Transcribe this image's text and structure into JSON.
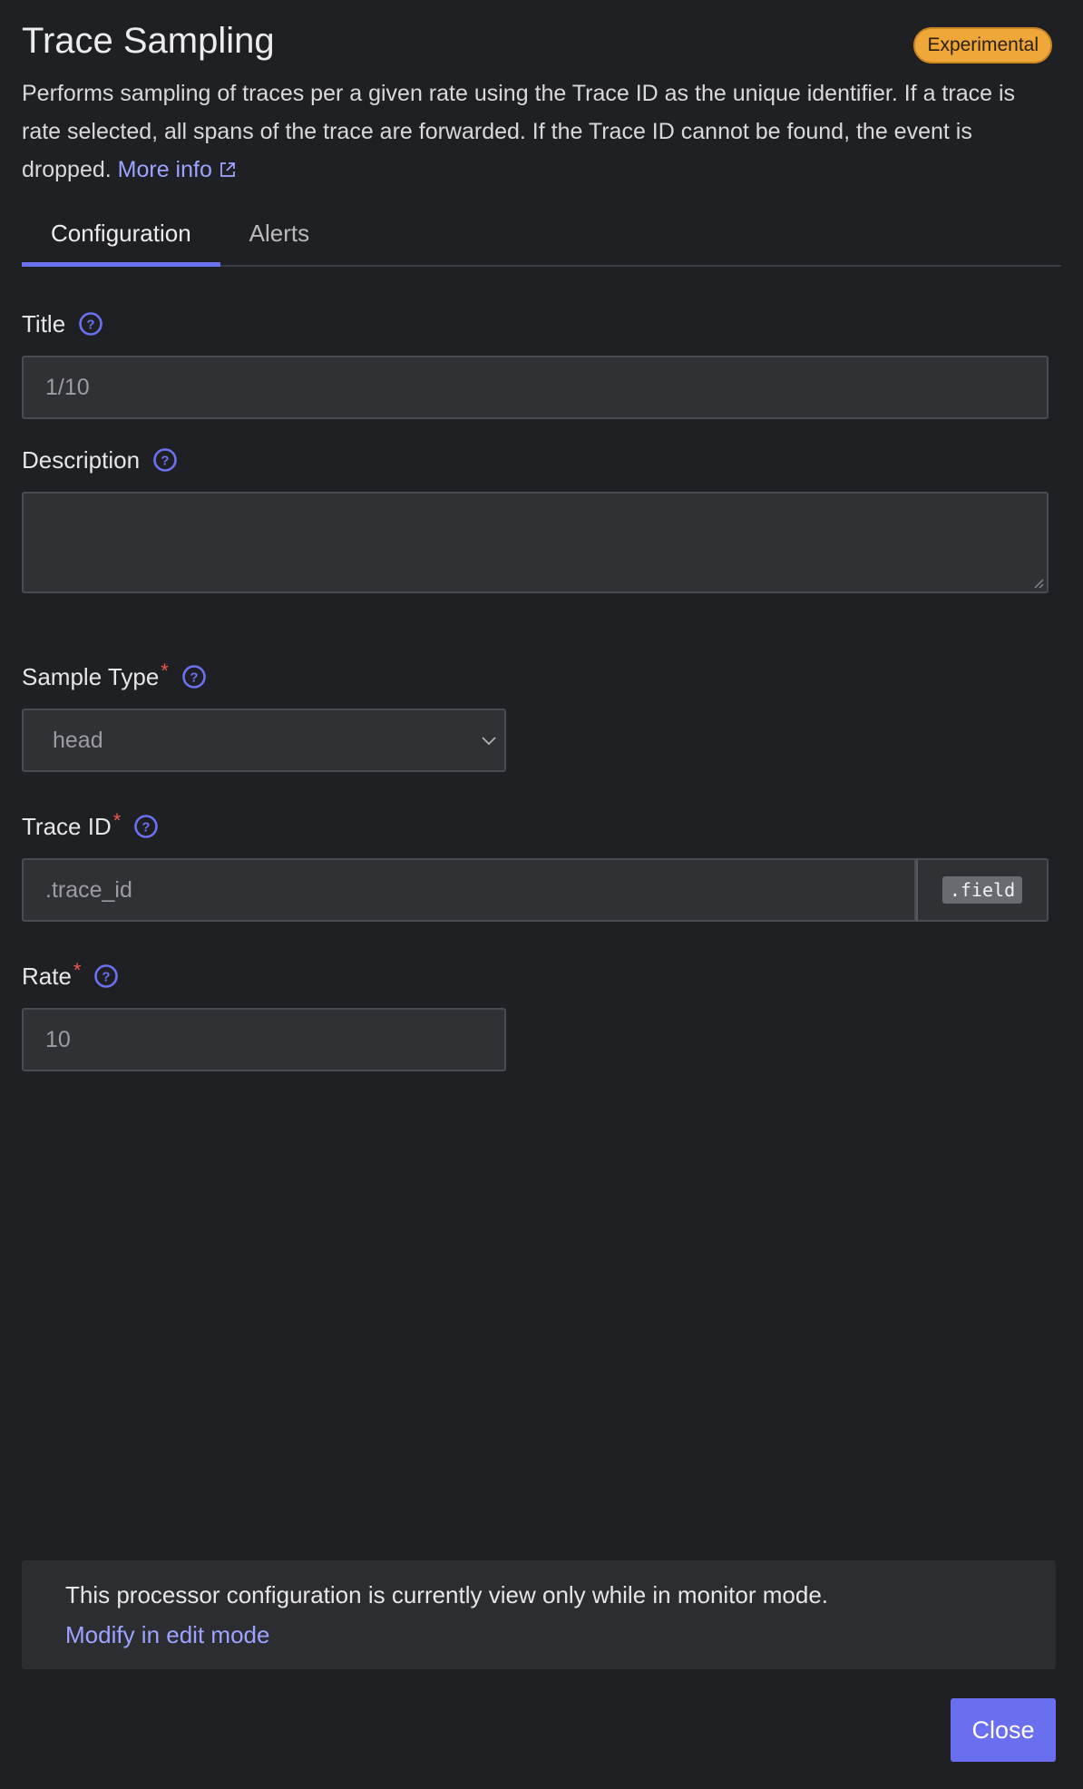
{
  "header": {
    "title": "Trace Sampling",
    "badge": "Experimental",
    "description": "Performs sampling of traces per a given rate using the Trace ID as the unique identifier. If a trace is rate selected, all spans of the trace are forwarded. If the Trace ID cannot be found, the event is dropped.",
    "more_info": "More info"
  },
  "tabs": [
    {
      "label": "Configuration",
      "active": true
    },
    {
      "label": "Alerts",
      "active": false
    }
  ],
  "form": {
    "title": {
      "label": "Title",
      "value": "1/10"
    },
    "description": {
      "label": "Description",
      "value": ""
    },
    "sample_type": {
      "label": "Sample Type",
      "required_mark": "*",
      "value": "head"
    },
    "trace_id": {
      "label": "Trace ID",
      "required_mark": "*",
      "value": ".trace_id",
      "addon": ".field"
    },
    "rate": {
      "label": "Rate",
      "required_mark": "*",
      "value": "10"
    }
  },
  "notice": {
    "text": "This processor configuration is currently view only while in monitor mode.",
    "link": "Modify in edit mode"
  },
  "footer": {
    "close_label": "Close"
  },
  "colors": {
    "accent": "#6b72f2",
    "link": "#9ca4ff",
    "badge": "#f0a73a",
    "required": "#ef5a4f",
    "background": "#1f2023"
  },
  "icons": {
    "help": "question-circle-icon",
    "external": "external-link-icon",
    "chevron": "chevron-down-icon",
    "resize": "resize-grip-icon"
  }
}
